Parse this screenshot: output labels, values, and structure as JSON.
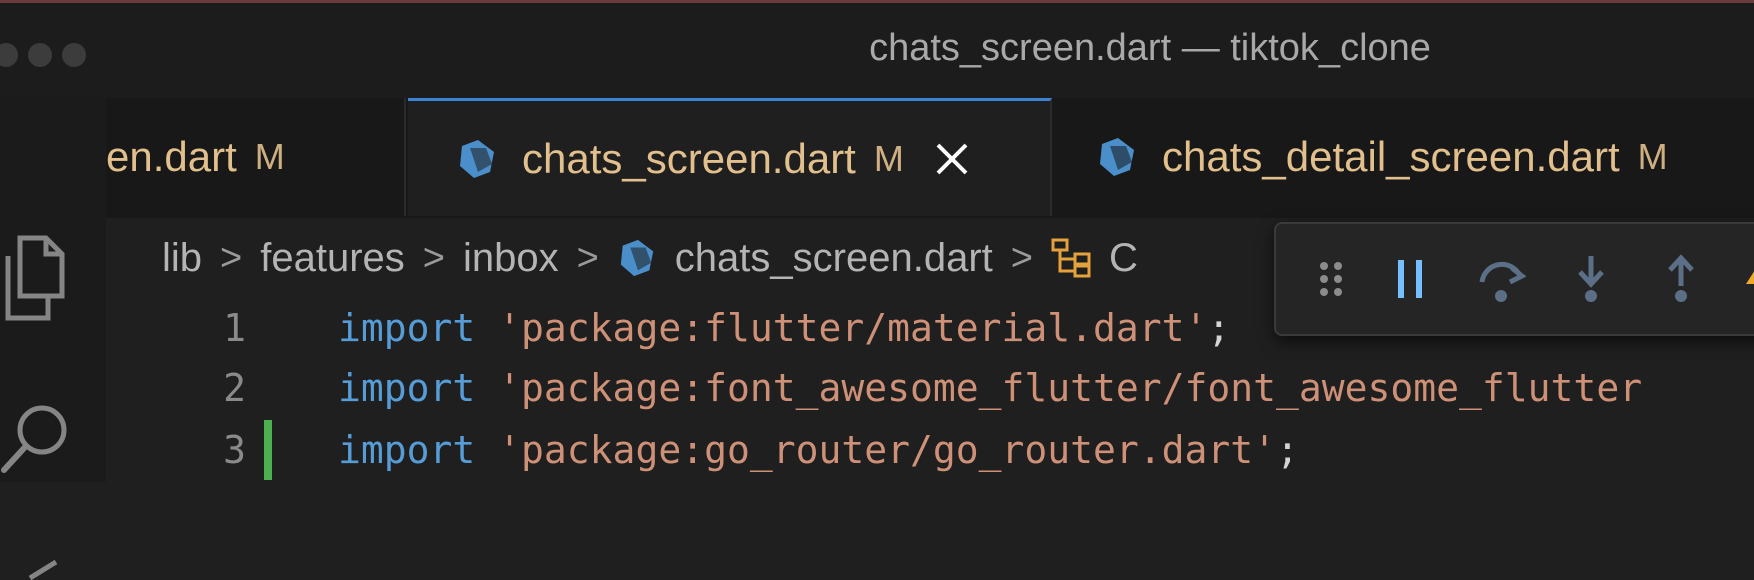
{
  "window": {
    "title": "chats_screen.dart — tiktok_clone"
  },
  "tabs": [
    {
      "label": "en.dart",
      "modified": "M",
      "active": false
    },
    {
      "label": "chats_screen.dart",
      "modified": "M",
      "active": true
    },
    {
      "label": "chats_detail_screen.dart",
      "modified": "M",
      "active": false
    }
  ],
  "breadcrumbs": {
    "items": [
      "lib",
      "features",
      "inbox",
      "chats_screen.dart"
    ],
    "partial": "C"
  },
  "editor": {
    "lines": [
      {
        "number": "1",
        "keyword": "import",
        "string": "'package:flutter/material.dart'",
        "tail": ";"
      },
      {
        "number": "2",
        "keyword": "import",
        "string": "'package:font_awesome_flutter/font_awesome_flutter",
        "tail": ""
      },
      {
        "number": "3",
        "keyword": "import",
        "string": "'package:go_router/go_router.dart'",
        "tail": ";"
      }
    ]
  },
  "colors": {
    "accent": "#3b82d6",
    "modified_text": "#e2c08d",
    "keyword": "#569cd6",
    "string": "#ce9178",
    "added_gutter": "#4caf50"
  },
  "icons": {
    "tab_file": "dart-file-icon",
    "tab_close": "close-icon",
    "activity": [
      "explorer-icon",
      "search-icon"
    ],
    "breadcrumb_symbol": "class-symbol-icon",
    "debug": [
      "drag-handle-icon",
      "pause-icon",
      "step-over-icon",
      "step-into-icon",
      "step-out-icon",
      "hot-reload-icon"
    ]
  }
}
